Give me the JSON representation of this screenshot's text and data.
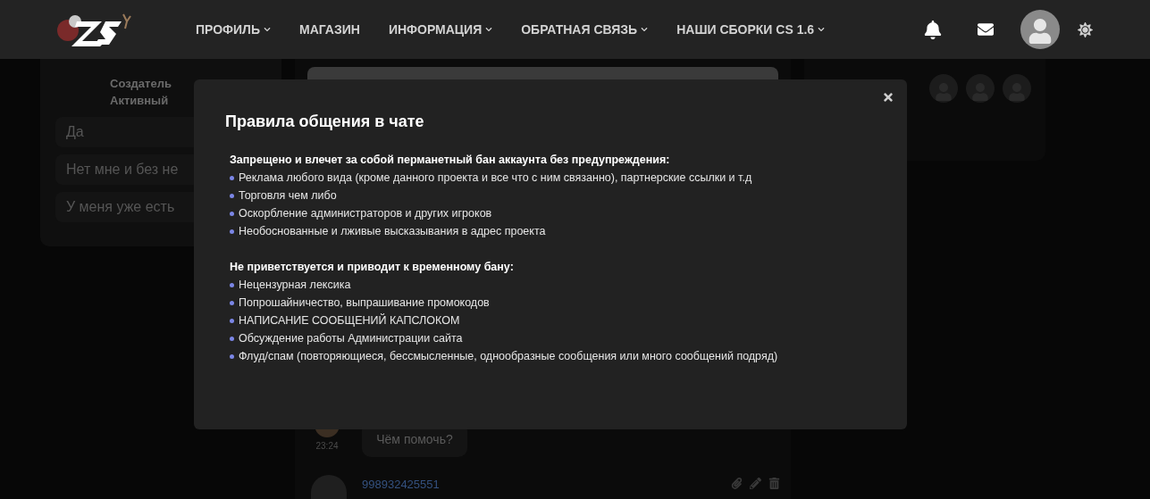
{
  "header": {
    "nav": [
      {
        "label": "ПРОФИЛЬ",
        "has_menu": true
      },
      {
        "label": "МАГАЗИН",
        "has_menu": false
      },
      {
        "label": "ИНФОРМАЦИЯ",
        "has_menu": true
      },
      {
        "label": "ОБРАТНАЯ СВЯЗЬ",
        "has_menu": true
      },
      {
        "label": "НАШИ СБОРКИ CS 1.6",
        "has_menu": true
      }
    ]
  },
  "poll": {
    "lines": [
      "Создатель",
      "Активный"
    ],
    "options": [
      "Да",
      "Нет мне и без не",
      "У меня уже есть"
    ]
  },
  "chat": {
    "messages": [
      {
        "time": "23:24",
        "text": "Чём помочь?"
      },
      {
        "author": "998932425551"
      }
    ]
  },
  "modal": {
    "title": "Правила общения в чате",
    "sections": [
      {
        "heading": "Запрещено и влечет за собой перманетный бан аккаунта без предупреждения:",
        "items": [
          "Реклама любого вида (кроме данного проекта и все что с ним связанно), партнерские ссылки и т.д",
          "Торговля чем либо",
          "Оскорбление администраторов и других игроков",
          "Необоснованные и лживые высказывания в адрес проекта"
        ]
      },
      {
        "heading": "Не приветствуется и приводит к временному бану:",
        "items": [
          "Нецензурная лексика",
          "Попрошайничество, выпрашивание промокодов",
          "НАПИСАНИЕ СООБЩЕНИЙ КАПСЛОКОМ",
          "Обсуждение работы Администрации сайта",
          "Флуд/спам (повторяющиеся, бессмысленные, однообразные сообщения или много сообщений подряд)"
        ]
      }
    ]
  }
}
